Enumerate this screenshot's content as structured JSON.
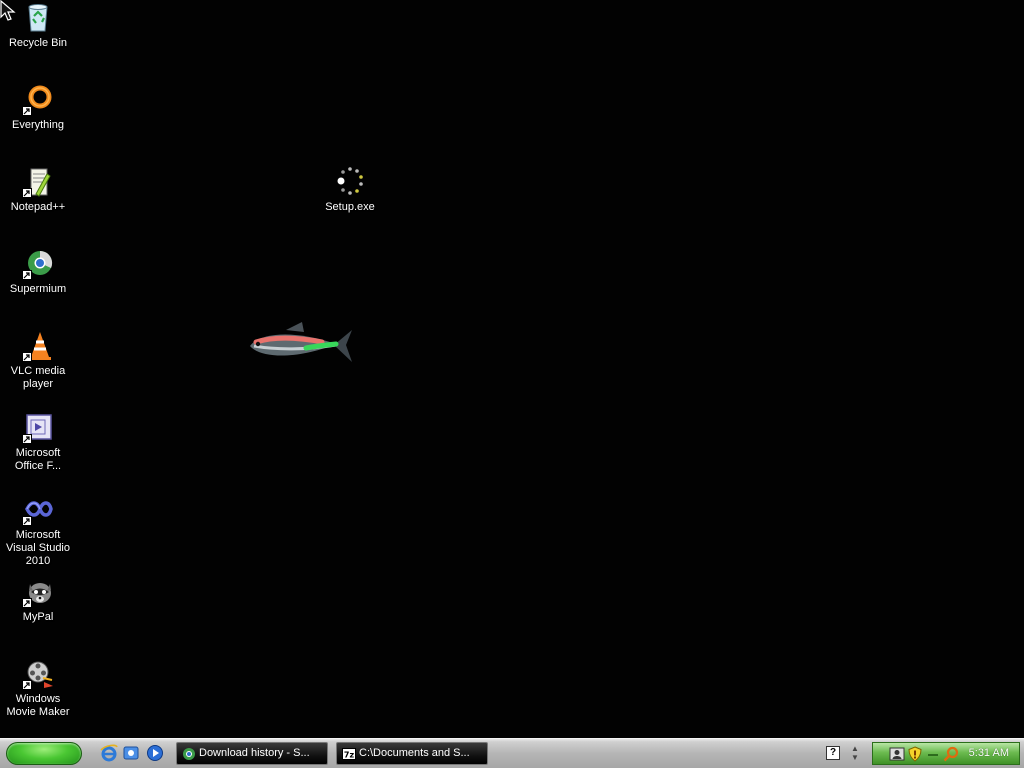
{
  "desktop": {
    "icons": [
      {
        "label": "Recycle Bin",
        "icon": "recycle-bin-icon"
      },
      {
        "label": "Everything",
        "icon": "everything-icon"
      },
      {
        "label": "Notepad++",
        "icon": "notepadpp-icon"
      },
      {
        "label": "Supermium",
        "icon": "supermium-icon"
      },
      {
        "label": "VLC media player",
        "icon": "vlc-icon"
      },
      {
        "label": "Microsoft Office F...",
        "icon": "office-icon"
      },
      {
        "label": "Microsoft Visual Studio 2010",
        "icon": "visual-studio-icon"
      },
      {
        "label": "MyPal",
        "icon": "mypal-icon"
      },
      {
        "label": "Windows Movie Maker",
        "icon": "movie-maker-icon"
      },
      {
        "label": "Setup.exe",
        "icon": "setup-loading-icon"
      }
    ]
  },
  "taskbar": {
    "quick_launch": [
      "internet-explorer-icon",
      "show-desktop-icon",
      "media-player-icon"
    ],
    "tasks": [
      {
        "label": "Download history - S...",
        "icon": "browser-icon"
      },
      {
        "label": "C:\\Documents and S...",
        "icon": "7zip-icon"
      }
    ],
    "help_label": "?",
    "tray": {
      "icons": [
        "network-user-icon",
        "security-shield-icon",
        "tray-dash-icon",
        "search-icon"
      ],
      "clock": "5:31 AM"
    }
  },
  "colors": {
    "desktop_bg": "#020202",
    "start_green": "#4ac733",
    "tray_green": "#6cbb50"
  }
}
